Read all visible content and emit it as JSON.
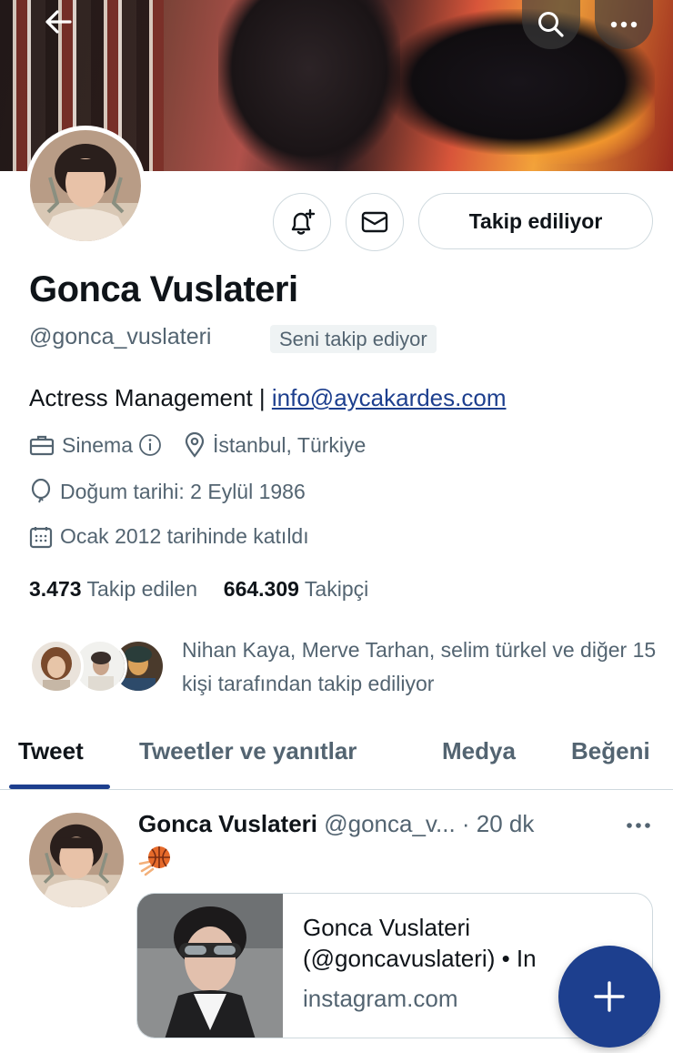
{
  "header": {
    "back_icon": "arrow-left-icon",
    "search_icon": "search-icon",
    "more_icon": "more-horizontal-icon"
  },
  "profile": {
    "name": "Gonca Vuslateri",
    "handle": "@gonca_vuslateri",
    "follows_you_badge": "Seni takip ediyor",
    "bio_text": "Actress Management | ",
    "bio_link": "info@aycakardes.com",
    "category": "Sinema",
    "location": "İstanbul, Türkiye",
    "birthday": "Doğum tarihi: 2 Eylül 1986",
    "joined": "Ocak 2012 tarihinde katıldı",
    "following_count": "3.473",
    "following_label": "Takip edilen",
    "followers_count": "664.309",
    "followers_label": "Takipçi",
    "followed_by_text": "Nihan Kaya, Merve Tarhan, selim türkel ve diğer 15 kişi tarafından takip ediliyor"
  },
  "actions": {
    "notify_icon": "bell-plus-icon",
    "message_icon": "envelope-icon",
    "follow_button_label": "Takip ediliyor"
  },
  "tabs": [
    {
      "label": "Tweet",
      "active": true
    },
    {
      "label": "Tweetler ve yanıtlar",
      "active": false
    },
    {
      "label": "Medya",
      "active": false
    },
    {
      "label": "Beğeni",
      "active": false
    }
  ],
  "tweet": {
    "author_name": "Gonca Vuslateri",
    "author_handle_and_time": "@gonca_v... · 20 dk",
    "emoji": "🏀",
    "card_title": "Gonca Vuslateri\n(@goncavuslateri) • In",
    "card_domain": "instagram.com"
  },
  "colors": {
    "accent": "#1d3f8e",
    "text_primary": "#0f1419",
    "text_secondary": "#536471",
    "border": "#cfd9de"
  },
  "fab_icon": "plus-icon"
}
